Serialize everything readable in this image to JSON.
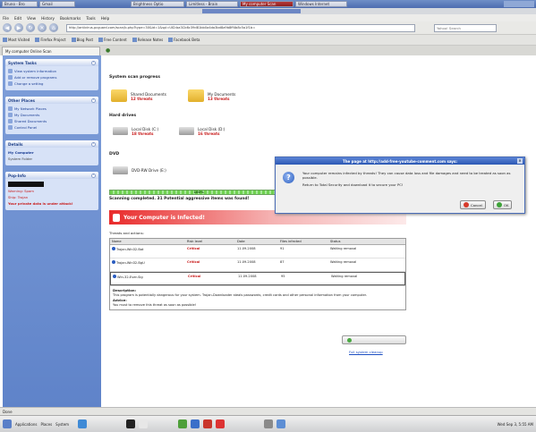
{
  "taskbar": {
    "tasks": [
      "Bruno - Bro",
      "Gmail",
      "Brightness Optio",
      "Limitless - Brain",
      "My computer Scan",
      "Windows Internet"
    ],
    "active_index": 4
  },
  "browser": {
    "menu": [
      "File",
      "Edit",
      "View",
      "History",
      "Bookmarks",
      "Tools",
      "Help"
    ],
    "url": "http://antivirus-pcguard.com/scan/b.php?type=30&id=1&spl=UID:ba3Cb6c39d81bb0a4da3bd8a9b8ff4b8c5a1f1b=",
    "search_placeholder": "Yahoo! Search",
    "bookmarks": [
      "Most Visited",
      "Firefox Project",
      "Blog Post",
      "Free Content",
      "Release Notes",
      "Facebook Beta"
    ],
    "tab_title": "My computer Online Scan"
  },
  "sidebar": {
    "system_tasks": {
      "title": "System Tasks",
      "items": [
        "View system information",
        "Add or remove programs",
        "Change a setting"
      ]
    },
    "other_places": {
      "title": "Other Places",
      "items": [
        "My Network Places",
        "My Documents",
        "Shared Documents",
        "Control Panel"
      ]
    },
    "details": {
      "title": "Details",
      "line1": "My Computer",
      "line2": "System Folder"
    },
    "popular": {
      "title": "Pop-Info",
      "line1": "Warning: Spam",
      "line2": "Ship: Trojan",
      "alert": "Your private data is under attack!"
    }
  },
  "main": {
    "heading": "System scan progress",
    "folders": [
      {
        "name": "Shared Documents",
        "threats": "12 threats"
      },
      {
        "name": "My Documents",
        "threats": "13 threats"
      }
    ],
    "hard_drives_label": "Hard drives",
    "drives": [
      {
        "name": "Local Disk (C:)",
        "threats": "18 threats"
      },
      {
        "name": "Local Disk (D:)",
        "threats": "16 threats"
      }
    ],
    "dvd_label": "DVD",
    "dvd_name": "DVD-RW Drive (E:)",
    "progress_label": "100%",
    "scan_result": "Scanning completed. 31 Potential aggressive items was found!",
    "banner": "Your Computer is Infected!",
    "threats_label": "Threats and actions:",
    "table_headers": [
      "Name",
      "Risk level",
      "Date",
      "Files infected",
      "Status"
    ],
    "rows": [
      {
        "name": "Trojan-Win32.Bat",
        "risk": "Critical",
        "date": "11.09.2008",
        "files": "91",
        "status": "Waiting removal"
      },
      {
        "name": "Trojan-Win32.BgU",
        "risk": "Critical",
        "date": "11.09.2008",
        "files": "87",
        "status": "Waiting removal"
      },
      {
        "name": "Win-32-Ever-Sig",
        "risk": "Critical",
        "date": "11.09.2008",
        "files": "95",
        "status": "Waiting removal"
      }
    ],
    "description_title": "Description:",
    "description": "This program is potentially dangerous for your system. Trojan-Downloader steals passwords, credit cards and other personal information from your computer.",
    "advice_title": "Advice:",
    "advice": "You must to remove this threat as soon as possible!",
    "remove_link": "Full system cleanup"
  },
  "dialog": {
    "title": "The page at http://add-free-youtube-comment.com says:",
    "message": "Your computer remains infected by threats! They can cause data loss and file damages and need to be treated as soon as possible.",
    "message2": "Return to Total Security and download it to secure your PC!",
    "cancel": "Cancel",
    "ok": "OK"
  },
  "status": {
    "text": "Done"
  },
  "panel": {
    "menu": [
      "Applications",
      "Places",
      "System"
    ],
    "clock": "Wed Sep 3, 5:55 AM"
  }
}
